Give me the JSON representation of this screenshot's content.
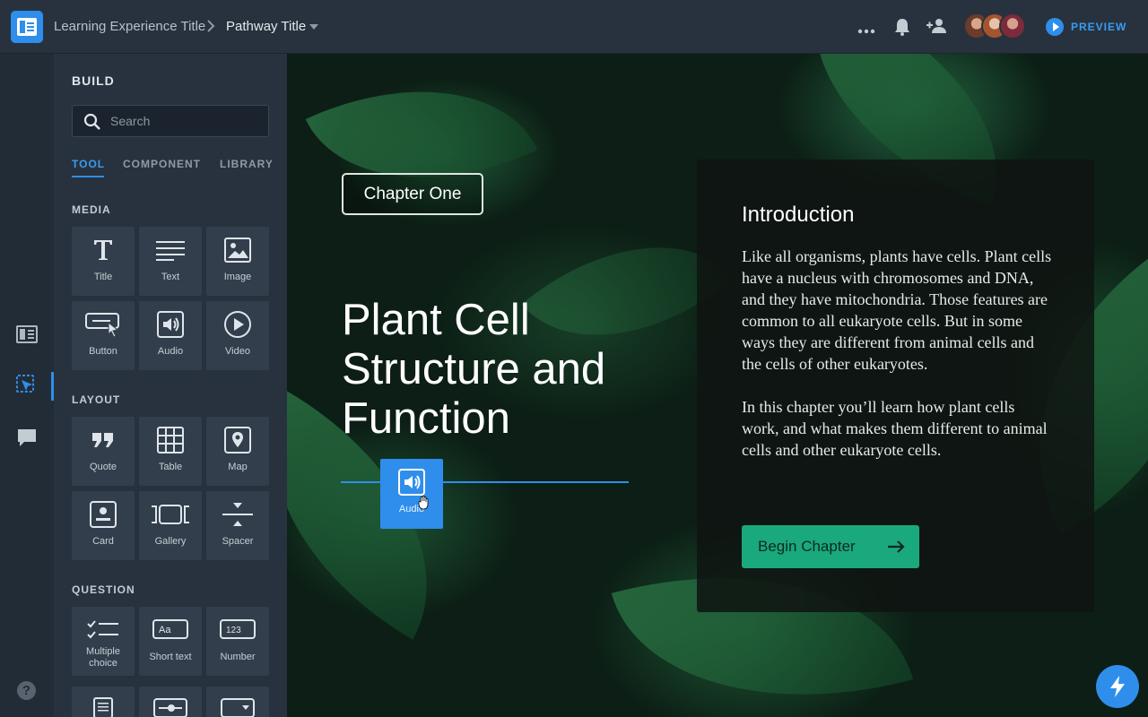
{
  "topbar": {
    "breadcrumb_parent": "Learning Experience Title",
    "breadcrumb_current": "Pathway Title",
    "preview_label": "PREVIEW"
  },
  "panel": {
    "title": "BUILD",
    "search_placeholder": "Search",
    "tabs": [
      "TOOL",
      "COMPONENT",
      "LIBRARY"
    ],
    "sections": {
      "media": {
        "label": "MEDIA",
        "tiles": [
          "Title",
          "Text",
          "Image",
          "Button",
          "Audio",
          "Video"
        ]
      },
      "layout": {
        "label": "LAYOUT",
        "tiles": [
          "Quote",
          "Table",
          "Map",
          "Card",
          "Gallery",
          "Spacer"
        ]
      },
      "question": {
        "label": "QUESTION",
        "tiles": [
          "Multiple choice",
          "Short text",
          "Number"
        ],
        "short_text_icon_text": "Aa",
        "number_icon_text": "123"
      }
    }
  },
  "canvas": {
    "chapter_tag": "Chapter One",
    "hero_title": "Plant Cell Structure and Function",
    "dragging_tile_label": "Audio",
    "info": {
      "title": "Introduction",
      "paragraphs": [
        "Like all organisms, plants have cells. Plant cells have a nucleus with chromosomes and DNA, and they have mitochondria. Those features are common to all eukaryote cells. But in some ways they are different from animal cells and the cells of other eukaryotes.",
        "In this chapter you’ll learn how plant cells work, and what makes them different to animal cells and other eukaryote cells."
      ],
      "button_label": "Begin Chapter"
    }
  },
  "rail": {
    "help_label": "?"
  },
  "colors": {
    "accent": "#2f8eeb",
    "begin_button": "#1aa87d",
    "topbar": "#27323e",
    "panel": "#27323e",
    "tile": "#323e4b"
  }
}
